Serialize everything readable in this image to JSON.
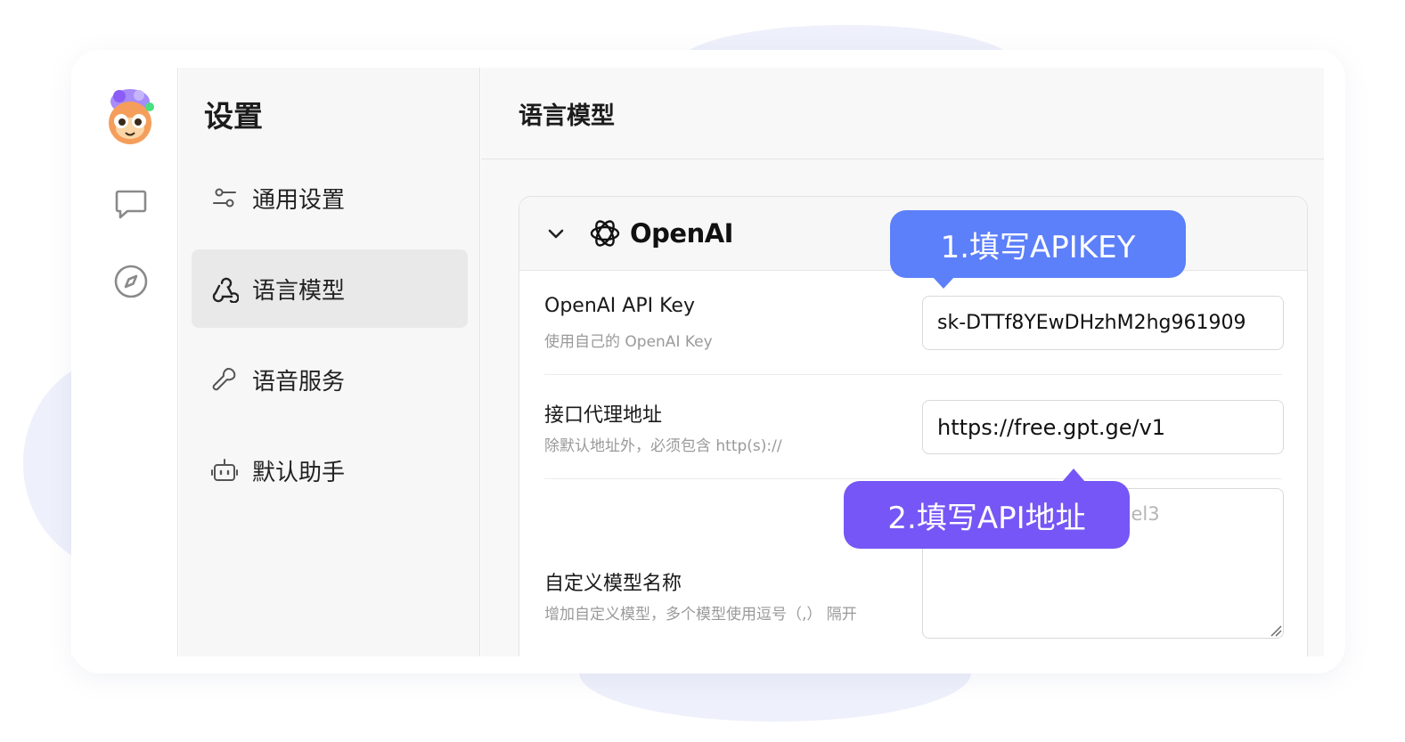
{
  "sidebar": {
    "title": "设置"
  },
  "nav": {
    "items": [
      {
        "label": "通用设置",
        "icon": "sliders-icon"
      },
      {
        "label": "语言模型",
        "icon": "webhook-icon",
        "active": true
      },
      {
        "label": "语音服务",
        "icon": "wrench-icon"
      },
      {
        "label": "默认助手",
        "icon": "robot-icon"
      }
    ]
  },
  "content": {
    "title": "语言模型",
    "provider": {
      "name": "OpenAI"
    },
    "fields": [
      {
        "label": "OpenAI API Key",
        "desc": "使用自己的 OpenAI Key",
        "value": "sk-DTTf8YEwDHzhM2hg961909"
      },
      {
        "label": "接口代理地址",
        "desc": "除默认地址外，必须包含 http(s)://",
        "value": "https://free.gpt.ge/v1"
      },
      {
        "label": "自定义模型名称",
        "desc": "增加自定义模型，多个模型使用逗号（,） 隔开",
        "placeholder": "model1,model2,model3"
      }
    ]
  },
  "callouts": [
    {
      "text": "1.填写APIKEY",
      "color": "#5c7ffa"
    },
    {
      "text": "2.填写API地址",
      "color": "#7656f6"
    }
  ],
  "rail": {
    "icons": [
      "avatar-icon",
      "chat-icon",
      "compass-icon"
    ]
  }
}
